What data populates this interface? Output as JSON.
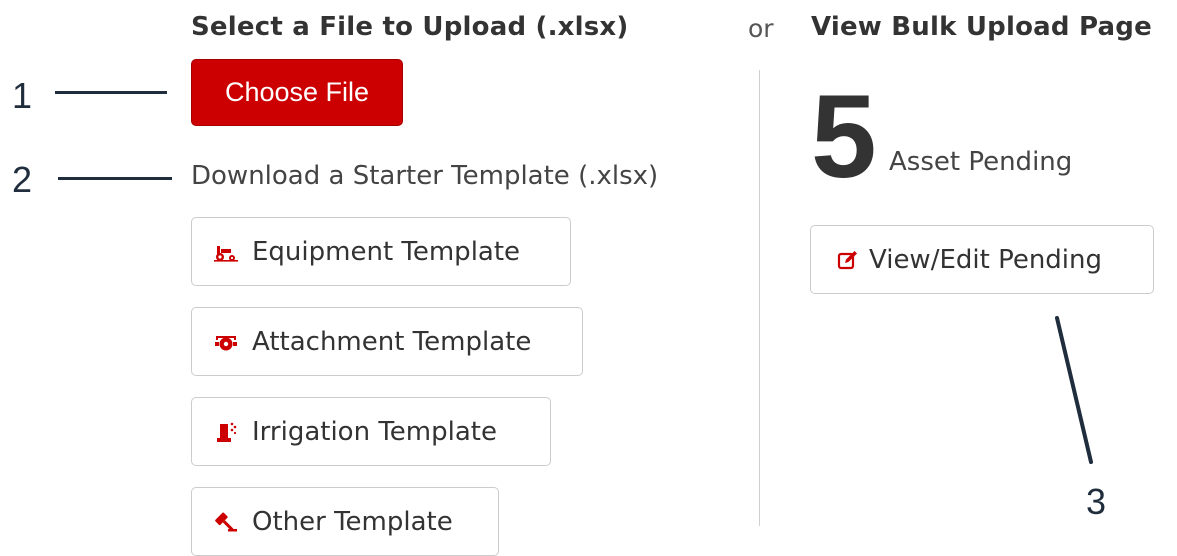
{
  "upload": {
    "heading": "Select a File to Upload (.xlsx)",
    "choose_file_label": "Choose File",
    "download_label": "Download a Starter Template (.xlsx)",
    "templates": [
      {
        "label": "Equipment Template",
        "icon": "tractor-icon"
      },
      {
        "label": "Attachment Template",
        "icon": "attachment-icon"
      },
      {
        "label": "Irrigation Template",
        "icon": "irrigation-icon"
      },
      {
        "label": "Other Template",
        "icon": "gavel-icon"
      }
    ]
  },
  "separator": "or",
  "bulk": {
    "heading": "View Bulk Upload Page",
    "pending_count": "5",
    "pending_label": "Asset Pending",
    "view_edit_label": "View/Edit Pending",
    "view_edit_icon": "edit-icon"
  },
  "callouts": [
    "1",
    "2",
    "3"
  ],
  "colors": {
    "accent": "#cc0000",
    "callout": "#1f2d3d",
    "text": "#333333",
    "border": "#cccccc"
  }
}
